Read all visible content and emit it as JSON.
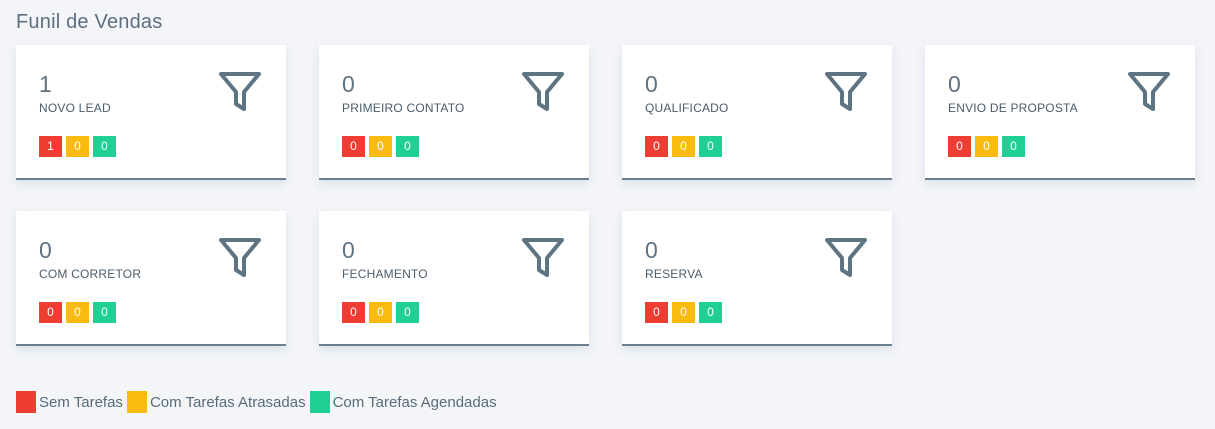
{
  "page": {
    "title": "Funil de Vendas"
  },
  "colors": {
    "red": "#ee3d32",
    "yellow": "#f9bb10",
    "green": "#1fcf94",
    "card_border": "#6a7f8f"
  },
  "cards": [
    {
      "count": "1",
      "label": "NOVO LEAD",
      "icon": "funnel-icon",
      "badges": {
        "sem_tarefas": "1",
        "atrasadas": "0",
        "agendadas": "0"
      }
    },
    {
      "count": "0",
      "label": "PRIMEIRO CONTATO",
      "icon": "funnel-icon",
      "badges": {
        "sem_tarefas": "0",
        "atrasadas": "0",
        "agendadas": "0"
      }
    },
    {
      "count": "0",
      "label": "QUALIFICADO",
      "icon": "funnel-icon",
      "badges": {
        "sem_tarefas": "0",
        "atrasadas": "0",
        "agendadas": "0"
      }
    },
    {
      "count": "0",
      "label": "ENVIO DE PROPOSTA",
      "icon": "funnel-icon",
      "badges": {
        "sem_tarefas": "0",
        "atrasadas": "0",
        "agendadas": "0"
      }
    },
    {
      "count": "0",
      "label": "COM CORRETOR",
      "icon": "funnel-icon",
      "badges": {
        "sem_tarefas": "0",
        "atrasadas": "0",
        "agendadas": "0"
      }
    },
    {
      "count": "0",
      "label": "FECHAMENTO",
      "icon": "funnel-icon",
      "badges": {
        "sem_tarefas": "0",
        "atrasadas": "0",
        "agendadas": "0"
      }
    },
    {
      "count": "0",
      "label": "RESERVA",
      "icon": "funnel-icon",
      "badges": {
        "sem_tarefas": "0",
        "atrasadas": "0",
        "agendadas": "0"
      }
    }
  ],
  "legend": {
    "sem_tarefas": "Sem Tarefas",
    "atrasadas": "Com Tarefas Atrasadas",
    "agendadas": "Com Tarefas Agendadas"
  }
}
